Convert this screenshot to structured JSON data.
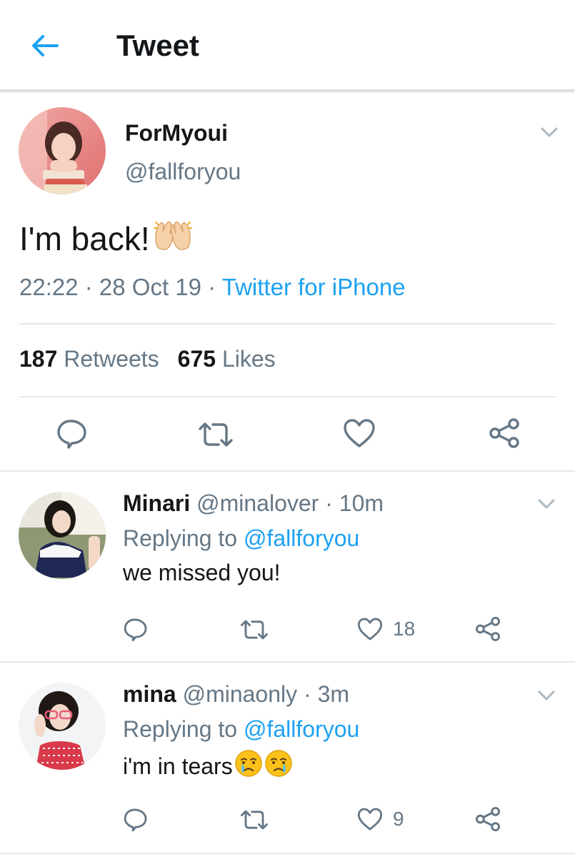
{
  "header": {
    "title": "Tweet"
  },
  "main_tweet": {
    "author_name": "ForMyoui",
    "author_handle": "@fallforyou",
    "text": "I'm back!",
    "time": "22:22",
    "date": "28 Oct 19",
    "source": "Twitter for iPhone",
    "separator": " · ",
    "retweets_count": "187",
    "retweets_label": "Retweets",
    "likes_count": "675",
    "likes_label": "Likes"
  },
  "replies": [
    {
      "name": "Minari",
      "handle": "@minalover",
      "time": "10m",
      "replying_prefix": "Replying to",
      "replying_to": "@fallforyou",
      "text": "we missed you!",
      "likes": "18"
    },
    {
      "name": "mina",
      "handle": "@minaonly",
      "time": "3m",
      "replying_prefix": "Replying to",
      "replying_to": "@fallforyou",
      "text": "i'm in tears",
      "likes": "9"
    }
  ],
  "colors": {
    "accent": "#1da1f2",
    "text": "#14171a",
    "secondary": "#657786",
    "border": "#e1e8ed"
  },
  "icons": [
    "back-arrow-icon",
    "chevron-down-icon",
    "reply-icon",
    "retweet-icon",
    "like-icon",
    "share-icon",
    "raised-hands-emoji",
    "crying-face-emoji"
  ]
}
